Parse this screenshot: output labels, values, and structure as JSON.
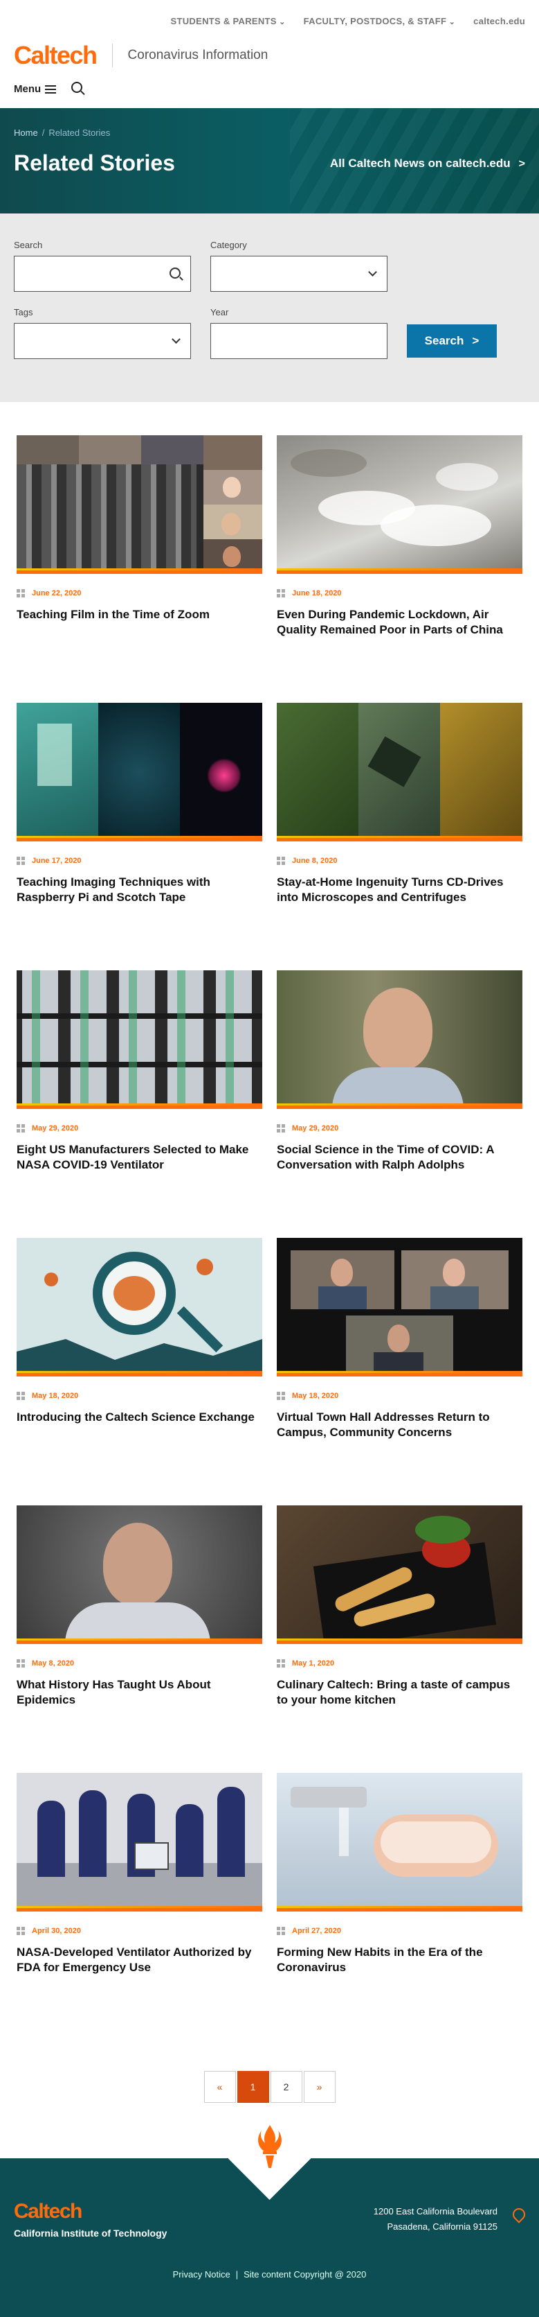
{
  "topbar": {
    "links": [
      "STUDENTS & PARENTS",
      "FACULTY, POSTDOCS, & STAFF",
      "caltech.edu"
    ]
  },
  "header": {
    "logo": "Caltech",
    "site_title": "Coronavirus Information",
    "menu_label": "Menu"
  },
  "hero": {
    "breadcrumb_home": "Home",
    "breadcrumb_sep": "/",
    "breadcrumb_current": "Related Stories",
    "title": "Related Stories",
    "all_news_link": "All Caltech News on caltech.edu",
    "all_news_chevron": ">"
  },
  "filters": {
    "search_label": "Search",
    "category_label": "Category",
    "tags_label": "Tags",
    "year_label": "Year",
    "search_value": "",
    "year_value": "",
    "submit_label": "Search",
    "submit_chevron": ">"
  },
  "stories": [
    {
      "date": "June 22, 2020",
      "title": "Teaching Film in the Time of Zoom"
    },
    {
      "date": "June 18, 2020",
      "title": "Even During Pandemic Lockdown, Air Quality Remained Poor in Parts of China"
    },
    {
      "date": "June 17, 2020",
      "title": "Teaching Imaging Techniques with Raspberry Pi and Scotch Tape"
    },
    {
      "date": "June 8, 2020",
      "title": "Stay-at-Home Ingenuity Turns CD-Drives into Microscopes and Centrifuges"
    },
    {
      "date": "May 29, 2020",
      "title": "Eight US Manufacturers Selected to Make NASA COVID-19 Ventilator"
    },
    {
      "date": "May 29, 2020",
      "title": "Social Science in the Time of COVID: A Conversation with Ralph Adolphs"
    },
    {
      "date": "May 18, 2020",
      "title": "Introducing the Caltech Science Exchange"
    },
    {
      "date": "May 18, 2020",
      "title": "Virtual Town Hall Addresses Return to Campus, Community Concerns"
    },
    {
      "date": "May 8, 2020",
      "title": "What History Has Taught Us About Epidemics"
    },
    {
      "date": "May 1, 2020",
      "title": "Culinary Caltech: Bring a taste of campus to your home kitchen"
    },
    {
      "date": "April 30, 2020",
      "title": "NASA-Developed Ventilator Authorized by FDA for Emergency Use"
    },
    {
      "date": "April 27, 2020",
      "title": "Forming New Habits in the Era of the Coronavirus"
    }
  ],
  "pagination": {
    "prev": "«",
    "pages": [
      "1",
      "2"
    ],
    "current": "1",
    "next": "»"
  },
  "footer": {
    "logo": "Caltech",
    "institute": "California Institute of Technology",
    "address_line1": "1200 East California Boulevard",
    "address_line2": "Pasadena, California 91125",
    "privacy": "Privacy Notice",
    "separator": "|",
    "copyright": "Site content Copyright @ 2020"
  },
  "colors": {
    "brand_orange": "#FF6C0C",
    "hero_teal": "#0a5f64",
    "search_button": "#0b74a8",
    "pager_active": "#d84a0c"
  }
}
